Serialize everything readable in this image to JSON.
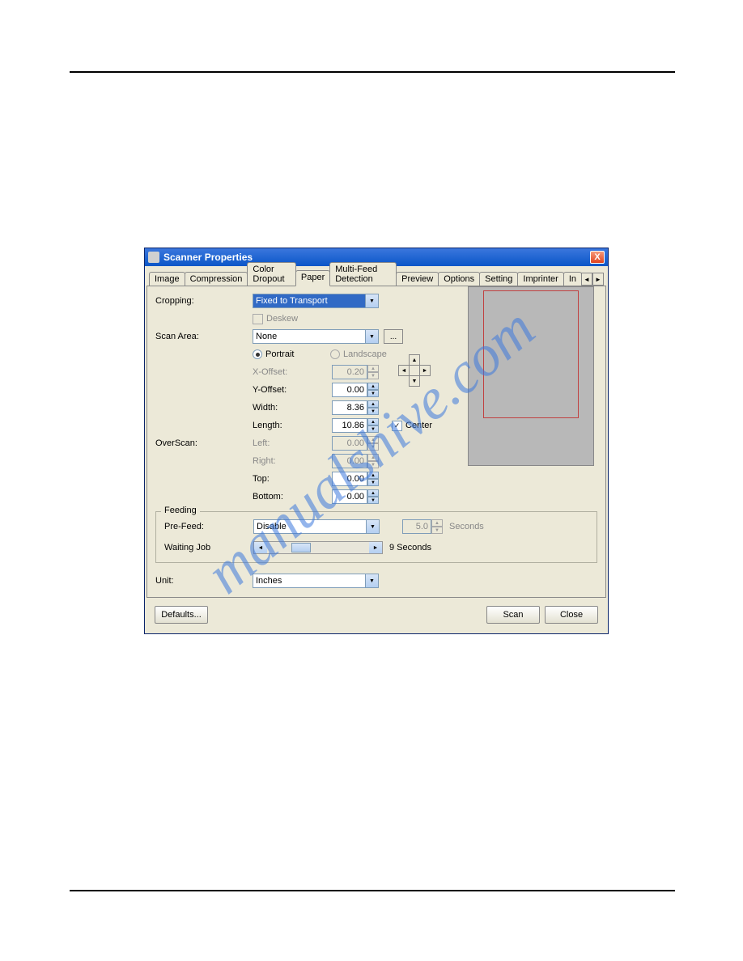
{
  "window": {
    "title": "Scanner Properties",
    "close_icon": "X"
  },
  "tabs": [
    "Image",
    "Compression",
    "Color Dropout",
    "Paper",
    "Multi-Feed Detection",
    "Preview",
    "Options",
    "Setting",
    "Imprinter",
    "In"
  ],
  "active_tab": "Paper",
  "labels": {
    "cropping": "Cropping:",
    "deskew": "Deskew",
    "scan_area": "Scan Area:",
    "portrait": "Portrait",
    "landscape": "Landscape",
    "x_offset": "X-Offset:",
    "y_offset": "Y-Offset:",
    "width": "Width:",
    "length": "Length:",
    "center": "Center",
    "overscan": "OverScan:",
    "left": "Left:",
    "right": "Right:",
    "top": "Top:",
    "bottom": "Bottom:",
    "feeding": "Feeding",
    "pre_feed": "Pre-Feed:",
    "waiting_job": "Waiting Job",
    "seconds": "Seconds",
    "waiting_value": "9 Seconds",
    "unit": "Unit:"
  },
  "values": {
    "cropping": "Fixed to Transport",
    "scan_area": "None",
    "x_offset": "0.20",
    "y_offset": "0.00",
    "width": "8.36",
    "length": "10.86",
    "left": "0.00",
    "right": "0.00",
    "top": "0.00",
    "bottom": "0.00",
    "pre_feed": "Disable",
    "pre_feed_seconds": "5.0",
    "unit": "Inches",
    "browse": "..."
  },
  "buttons": {
    "defaults": "Defaults...",
    "scan": "Scan",
    "close": "Close"
  },
  "chart_data": {
    "type": "table",
    "title": "Scanner Properties - Paper Tab",
    "fields": [
      {
        "name": "Cropping",
        "value": "Fixed to Transport"
      },
      {
        "name": "Deskew",
        "value": false,
        "enabled": false
      },
      {
        "name": "Scan Area",
        "value": "None"
      },
      {
        "name": "Orientation",
        "value": "Portrait",
        "options": [
          "Portrait",
          "Landscape"
        ]
      },
      {
        "name": "X-Offset",
        "value": 0.2,
        "unit": "Inches",
        "enabled": false
      },
      {
        "name": "Y-Offset",
        "value": 0.0,
        "unit": "Inches"
      },
      {
        "name": "Width",
        "value": 8.36,
        "unit": "Inches"
      },
      {
        "name": "Length",
        "value": 10.86,
        "unit": "Inches"
      },
      {
        "name": "Center",
        "value": true
      },
      {
        "name": "OverScan Left",
        "value": 0.0,
        "enabled": false
      },
      {
        "name": "OverScan Right",
        "value": 0.0,
        "enabled": false
      },
      {
        "name": "OverScan Top",
        "value": 0.0
      },
      {
        "name": "OverScan Bottom",
        "value": 0.0
      },
      {
        "name": "Pre-Feed",
        "value": "Disable"
      },
      {
        "name": "Pre-Feed Seconds",
        "value": 5.0,
        "enabled": false
      },
      {
        "name": "Waiting Job",
        "value": 9,
        "unit": "Seconds"
      },
      {
        "name": "Unit",
        "value": "Inches"
      }
    ]
  }
}
